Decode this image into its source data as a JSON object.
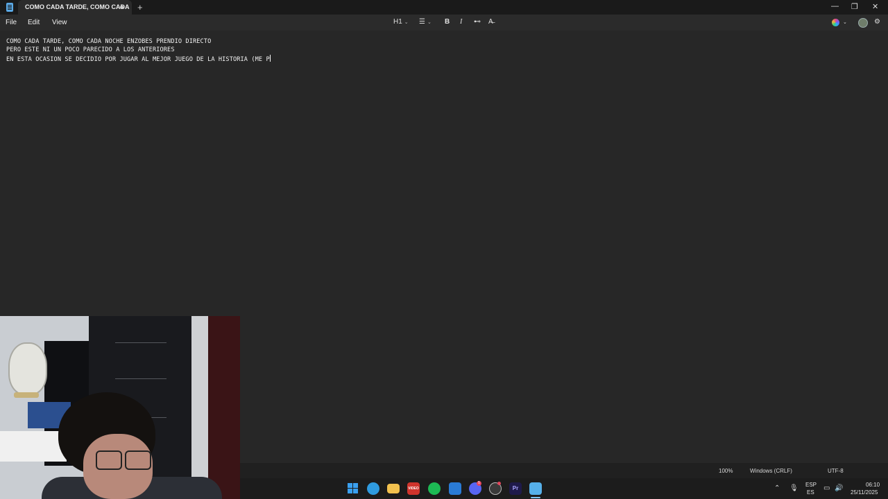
{
  "window": {
    "tab_title": "COMO CADA TARDE, COMO CADA",
    "new_tab_symbol": "+",
    "controls": {
      "minimize": "—",
      "restore": "❐",
      "close": "✕"
    }
  },
  "menu": {
    "file": "File",
    "edit": "Edit",
    "view": "View"
  },
  "toolbar": {
    "heading": "H1",
    "list": "☰",
    "bold": "B",
    "italic": "I",
    "link": "⊷",
    "clear_format": "A̶",
    "settings": "⚙"
  },
  "editor": {
    "lines": [
      "COMO CADA TARDE, COMO CADA NOCHE ENZOBES PRENDIO DIRECTO",
      "PERO ESTE NI UN POCO PARECIDO A LOS ANTERIORES",
      "EN ESTA OCASION SE DECIDIO POR JUGAR AL MEJOR JUEGO DE LA HISTORIA (ME P"
    ]
  },
  "statusbar": {
    "zoom": "100%",
    "line_ending": "Windows (CRLF)",
    "encoding": "UTF-8"
  },
  "taskbar": {
    "apps": [
      {
        "name": "windows-start",
        "color": "#3aa0f0"
      },
      {
        "name": "edge",
        "color": "#2f9be0"
      },
      {
        "name": "file-explorer",
        "color": "#f2c14e"
      },
      {
        "name": "video-app",
        "color": "#d0342c",
        "label": "VIDEO"
      },
      {
        "name": "spotify",
        "color": "#1db954"
      },
      {
        "name": "remote-app",
        "color": "#2a7bd6"
      },
      {
        "name": "discord",
        "color": "#5865f2",
        "badge": "5"
      },
      {
        "name": "obs",
        "color": "#3a3a3a"
      },
      {
        "name": "premiere-pro",
        "color": "#1f1a4a",
        "label": "Pr"
      },
      {
        "name": "notepad",
        "color": "#56b0ea"
      }
    ],
    "tray": {
      "language_top": "ESP",
      "language_bottom": "ES",
      "time": "06:10",
      "date": "25/11/2025"
    }
  }
}
